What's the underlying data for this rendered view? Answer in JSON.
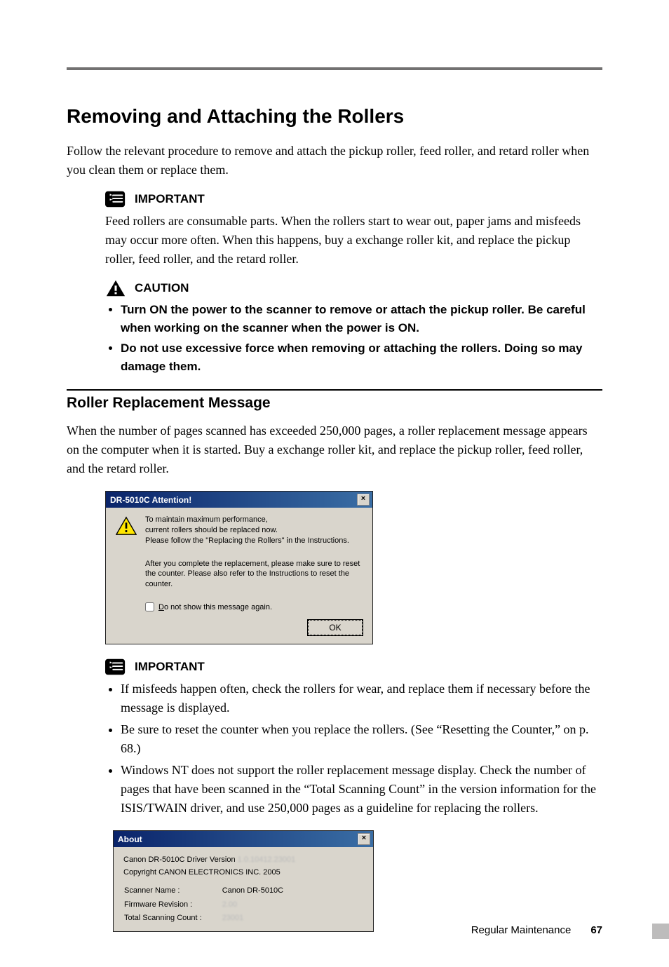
{
  "section_title": "Removing and Attaching the Rollers",
  "intro": "Follow the relevant procedure to remove and attach the pickup roller, feed roller, and retard roller when you clean them or replace them.",
  "important1": {
    "label": "IMPORTANT",
    "text": "Feed rollers are consumable parts. When the rollers start to wear out, paper jams and misfeeds may occur more often. When this happens, buy a exchange roller kit, and replace the pickup roller, feed roller, and the retard roller."
  },
  "caution": {
    "label": "CAUTION",
    "bullets": [
      "Turn ON the power to the scanner to remove or attach the pickup roller. Be careful when working on the scanner when the power is ON.",
      "Do not use excessive force when removing or attaching the rollers. Doing so may damage them."
    ]
  },
  "subsection_title": "Roller Replacement Message",
  "sub_intro": "When the number of pages scanned has exceeded 250,000 pages, a roller replacement message appears on the computer when it is started. Buy a exchange roller kit, and replace the pickup roller, feed roller, and the retard roller.",
  "dialog1": {
    "title": "DR-5010C Attention!",
    "msg1_l1": "To maintain maximum performance,",
    "msg1_l2": "current rollers should be replaced now.",
    "msg1_l3": "Please follow the \"Replacing the Rollers\" in the Instructions.",
    "msg2": "After you complete the replacement, please make sure to reset the counter. Please also refer to the Instructions to reset the counter.",
    "checkbox_prefix": "D",
    "checkbox_rest": "o not show this message again.",
    "ok": "OK",
    "close": "×"
  },
  "important2": {
    "label": "IMPORTANT",
    "bullets": [
      "If misfeeds happen often, check the rollers for wear, and replace them if necessary before the message is displayed.",
      "Be sure to reset the counter when you replace the rollers. (See “Resetting the Counter,” on p. 68.)",
      "Windows NT does not support the roller replacement message display. Check the number of pages that have been scanned in the “Total Scanning Count”  in the version information for the ISIS/TWAIN driver, and use 250,000 pages as a guideline for replacing the rollers."
    ]
  },
  "dialog2": {
    "title": "About",
    "line1_a": "Canon DR-5010C Driver Version ",
    "line1_b": "1.0.10412.23001",
    "line2": "Copyright CANON ELECTRONICS INC. 2005",
    "rows": [
      {
        "k": "Scanner Name :",
        "v": "Canon DR-5010C",
        "blur": false
      },
      {
        "k": "Firmware Revision :",
        "v": "2.00",
        "blur": true
      },
      {
        "k": "Total Scanning Count :",
        "v": "23001",
        "blur": true
      }
    ],
    "close": "×"
  },
  "footer": {
    "chapter": "Regular Maintenance",
    "page": "67"
  }
}
